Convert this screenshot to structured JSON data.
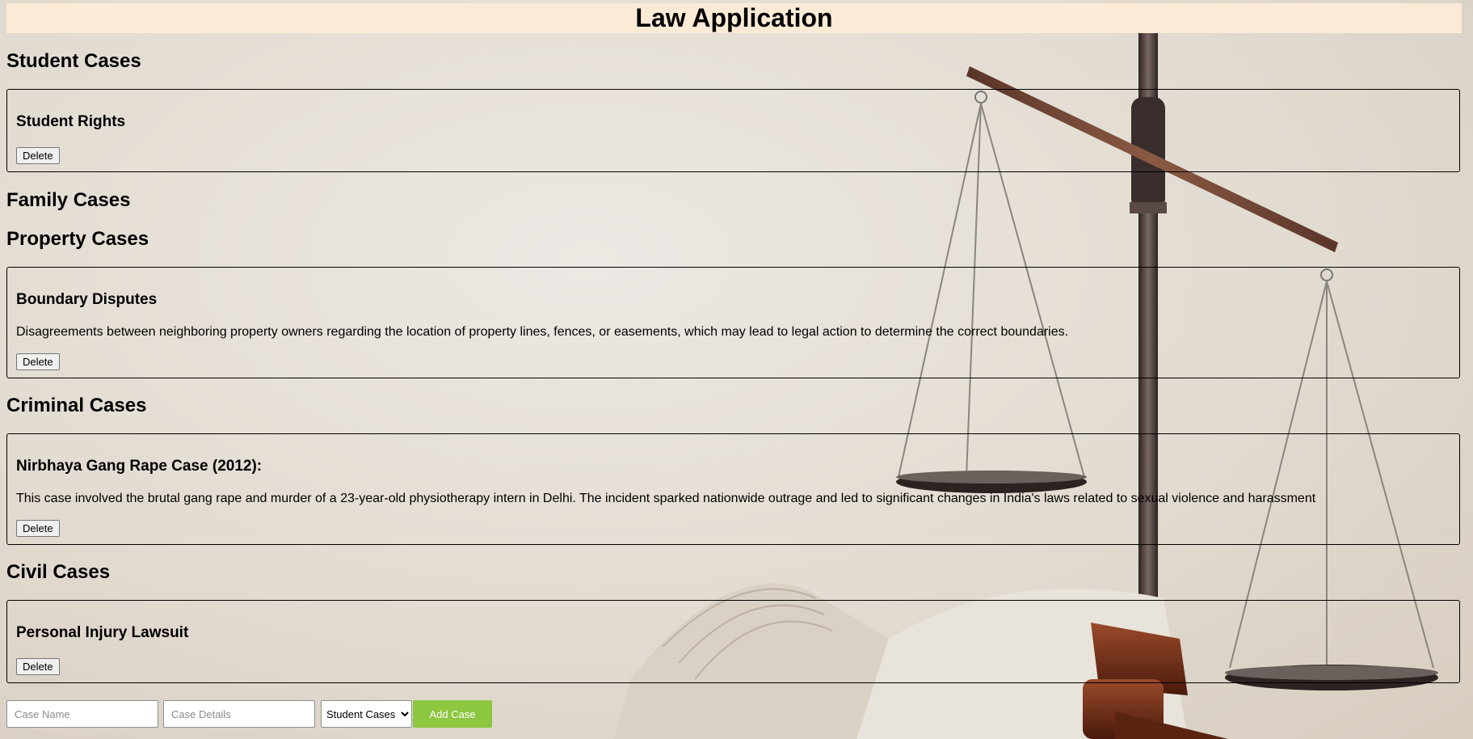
{
  "app": {
    "title": "Law Application"
  },
  "categories": [
    {
      "name": "Student Cases",
      "cases": [
        {
          "title": "Student Rights",
          "details": ""
        }
      ]
    },
    {
      "name": "Family Cases",
      "cases": []
    },
    {
      "name": "Property Cases",
      "cases": [
        {
          "title": "Boundary Disputes",
          "details": "Disagreements between neighboring property owners regarding the location of property lines, fences, or easements, which may lead to legal action to determine the correct boundaries."
        }
      ]
    },
    {
      "name": "Criminal Cases",
      "cases": [
        {
          "title": "Nirbhaya Gang Rape Case (2012):",
          "details": "This case involved the brutal gang rape and murder of a 23-year-old physiotherapy intern in Delhi. The incident sparked nationwide outrage and led to significant changes in India's laws related to sexual violence and harassment"
        }
      ]
    },
    {
      "name": "Civil Cases",
      "cases": [
        {
          "title": "Personal Injury Lawsuit",
          "details": ""
        }
      ]
    }
  ],
  "buttons": {
    "delete_label": "Delete",
    "add_label": "Add Case"
  },
  "form": {
    "case_name_placeholder": "Case Name",
    "case_details_placeholder": "Case Details",
    "category_selected": "Student Cases",
    "category_options": [
      "Student Cases",
      "Family Cases",
      "Property Cases",
      "Criminal Cases",
      "Civil Cases"
    ]
  },
  "colors": {
    "title_bar": "#fbebd6",
    "add_button": "#8dc63f"
  },
  "background": {
    "icons": [
      "scales-of-justice-icon",
      "open-book-icon",
      "gavel-icon"
    ]
  }
}
